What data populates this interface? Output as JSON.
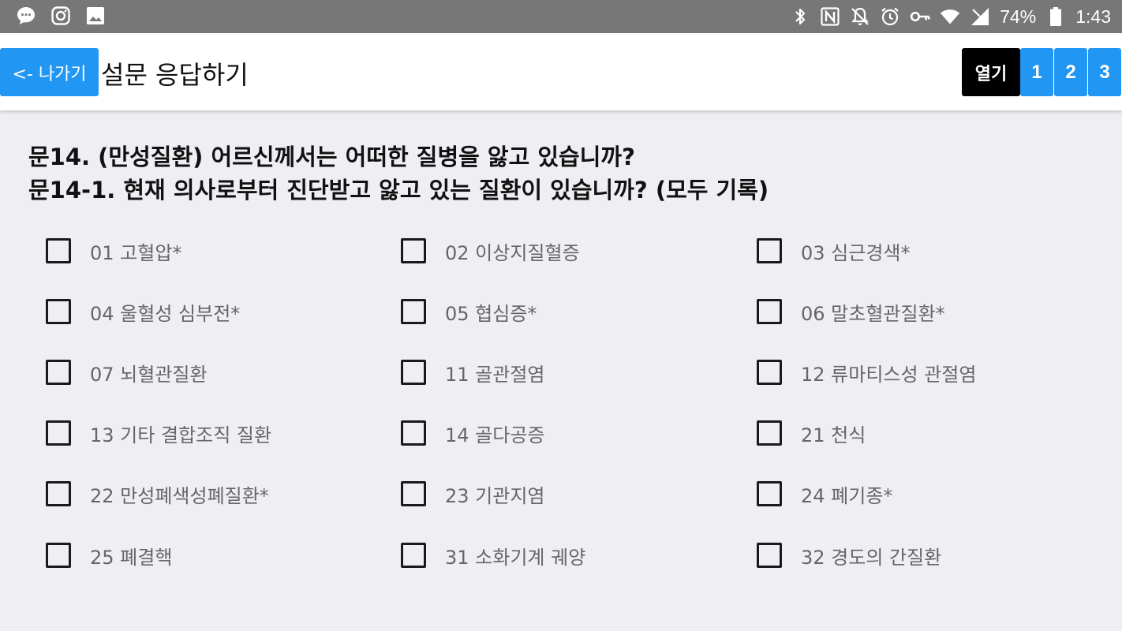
{
  "status_bar": {
    "battery_percent": "74%",
    "time": "1:43",
    "left_icons": [
      "message-icon",
      "instagram-icon",
      "gallery-icon"
    ],
    "right_icons": [
      "bluetooth-icon",
      "nfc-icon",
      "mute-icon",
      "alarm-icon",
      "key-icon",
      "wifi-icon",
      "signal-icon",
      "battery-icon"
    ]
  },
  "appbar": {
    "back_label": "<- 나가기",
    "title": "설문 응답하기",
    "open_label": "열기",
    "pages": [
      "1",
      "2",
      "3"
    ]
  },
  "question": {
    "line1": "문14. (만성질환) 어르신께서는 어떠한 질병을 앓고 있습니까?",
    "line2": "문14-1. 현재 의사로부터 진단받고 앓고 있는 질환이 있습니까? (모두 기록)"
  },
  "options": [
    {
      "label": "01 고혈압*",
      "checked": false
    },
    {
      "label": "02 이상지질혈증",
      "checked": false
    },
    {
      "label": "03 심근경색*",
      "checked": false
    },
    {
      "label": "04 울혈성 심부전*",
      "checked": false
    },
    {
      "label": "05 협심증*",
      "checked": false
    },
    {
      "label": "06 말초혈관질환*",
      "checked": false
    },
    {
      "label": "07 뇌혈관질환",
      "checked": false
    },
    {
      "label": "11 골관절염",
      "checked": false
    },
    {
      "label": "12 류마티스성 관절염",
      "checked": false
    },
    {
      "label": "13 기타 결합조직 질환",
      "checked": false
    },
    {
      "label": "14 골다공증",
      "checked": false
    },
    {
      "label": "21 천식",
      "checked": false
    },
    {
      "label": "22 만성폐색성폐질환*",
      "checked": false
    },
    {
      "label": "23 기관지염",
      "checked": false
    },
    {
      "label": "24 폐기종*",
      "checked": false
    },
    {
      "label": "25 폐결핵",
      "checked": false
    },
    {
      "label": "31 소화기계 궤양",
      "checked": false
    },
    {
      "label": "32 경도의 간질환",
      "checked": false
    }
  ],
  "colors": {
    "accent": "#2196f3",
    "status_bar": "#777777",
    "background": "#efeef3",
    "open_button": "#000000",
    "option_text": "#666666"
  }
}
